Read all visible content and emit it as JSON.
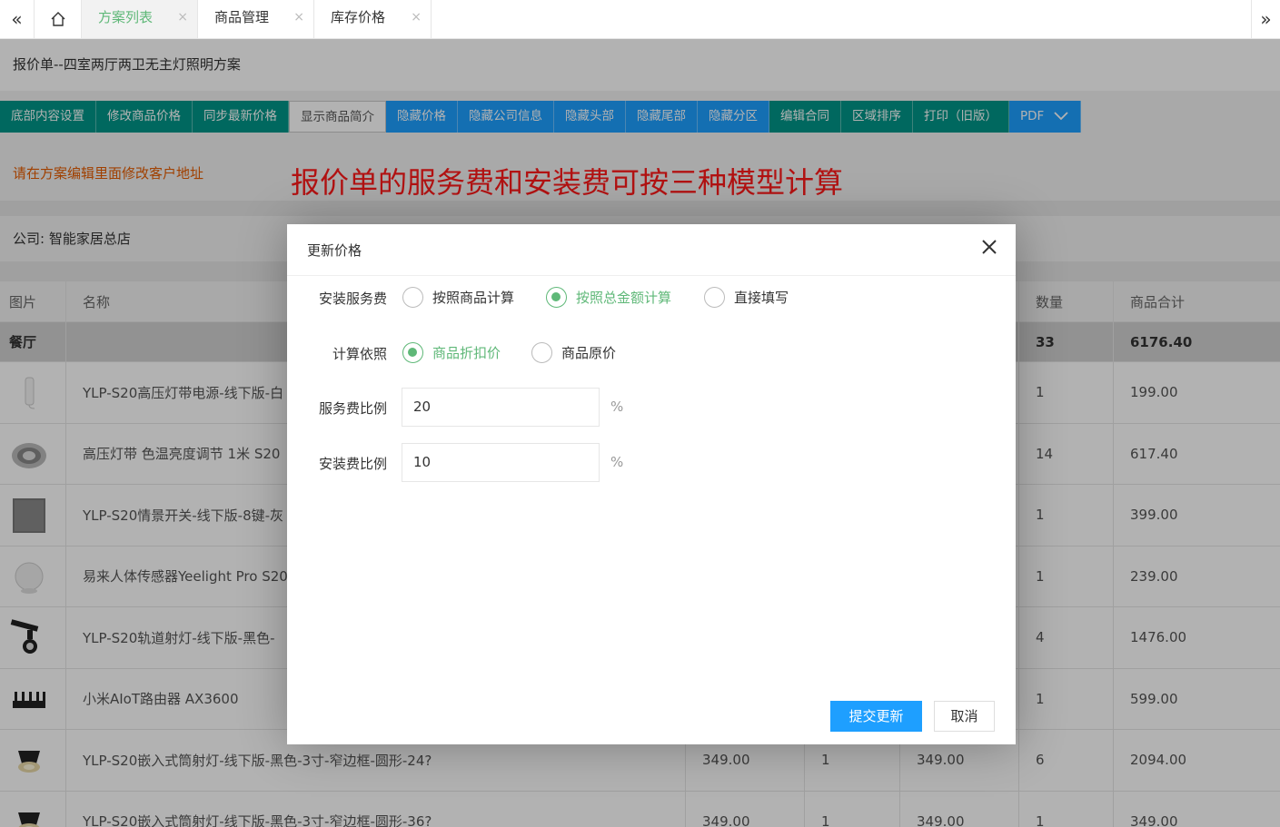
{
  "tabs": {
    "items": [
      {
        "label": "方案列表",
        "active": true
      },
      {
        "label": "商品管理",
        "active": false
      },
      {
        "label": "库存价格",
        "active": false
      }
    ],
    "close_glyph": "×"
  },
  "page": {
    "title": "报价单--四室两厅两卫无主灯照明方案",
    "toolbar": [
      {
        "label": "底部内容设置",
        "style": "green"
      },
      {
        "label": "修改商品价格",
        "style": "green"
      },
      {
        "label": "同步最新价格",
        "style": "green"
      },
      {
        "label": "显示商品简介",
        "style": "white"
      },
      {
        "label": "隐藏价格",
        "style": "blue"
      },
      {
        "label": "隐藏公司信息",
        "style": "blue"
      },
      {
        "label": "隐藏头部",
        "style": "blue"
      },
      {
        "label": "隐藏尾部",
        "style": "blue"
      },
      {
        "label": "隐藏分区",
        "style": "blue"
      },
      {
        "label": "编辑合同",
        "style": "green"
      },
      {
        "label": "区域排序",
        "style": "green"
      },
      {
        "label": "打印（旧版）",
        "style": "green"
      },
      {
        "label": "PDF",
        "style": "blue"
      }
    ],
    "warning": "请在方案编辑里面修改客户地址",
    "banner": "报价单的服务费和安装费可按三种模型计算",
    "company": "公司: 智能家居总店"
  },
  "table": {
    "headers": {
      "image": "图片",
      "name": "名称",
      "qty": "数量",
      "subtotal": "商品合计"
    },
    "group": {
      "name": "餐厅",
      "qty": "33",
      "subtotal": "6176.40"
    },
    "rows": [
      {
        "name": "YLP-S20高压灯带电源-线下版-白",
        "price": "",
        "discount": "",
        "dprice": "",
        "qty": "1",
        "subtotal": "199.00",
        "icon": "power-supply"
      },
      {
        "name": "高压灯带 色温亮度调节 1米 S20",
        "price": "",
        "discount": "",
        "dprice": "",
        "qty": "14",
        "subtotal": "617.40",
        "icon": "led-strip"
      },
      {
        "name": "YLP-S20情景开关-线下版-8键-灰",
        "price": "",
        "discount": "",
        "dprice": "",
        "qty": "1",
        "subtotal": "399.00",
        "icon": "switch-panel"
      },
      {
        "name": "易来人体传感器Yeelight Pro S20",
        "price": "",
        "discount": "",
        "dprice": "",
        "qty": "1",
        "subtotal": "239.00",
        "icon": "sensor"
      },
      {
        "name": "YLP-S20轨道射灯-线下版-黑色-",
        "price": "",
        "discount": "",
        "dprice": "",
        "qty": "4",
        "subtotal": "1476.00",
        "icon": "track-light"
      },
      {
        "name": "小米AIoT路由器 AX3600",
        "price": "",
        "discount": "",
        "dprice": "",
        "qty": "1",
        "subtotal": "599.00",
        "icon": "router"
      },
      {
        "name": "YLP-S20嵌入式筒射灯-线下版-黑色-3寸-窄边框-圆形-24?",
        "price": "349.00",
        "discount": "1",
        "dprice": "349.00",
        "qty": "6",
        "subtotal": "2094.00",
        "icon": "downlight"
      },
      {
        "name": "YLP-S20嵌入式筒射灯-线下版-黑色-3寸-窄边框-圆形-36?",
        "price": "349.00",
        "discount": "1",
        "dprice": "349.00",
        "qty": "1",
        "subtotal": "349.00",
        "icon": "downlight"
      }
    ]
  },
  "modal": {
    "title": "更新价格",
    "install_service": {
      "label": "安装服务费",
      "options": [
        "按照商品计算",
        "按照总金额计算",
        "直接填写"
      ],
      "selected": 1
    },
    "basis": {
      "label": "计算依照",
      "options": [
        "商品折扣价",
        "商品原价"
      ],
      "selected": 0
    },
    "service_ratio": {
      "label": "服务费比例",
      "value": "20",
      "unit": "%"
    },
    "install_ratio": {
      "label": "安装费比例",
      "value": "10",
      "unit": "%"
    },
    "submit_label": "提交更新",
    "cancel_label": "取消"
  },
  "colors": {
    "accent_green": "#5fb878",
    "teal": "#009688",
    "blue": "#1e9fff",
    "warning": "#e65c00",
    "banner_red": "#ff1a1a"
  }
}
